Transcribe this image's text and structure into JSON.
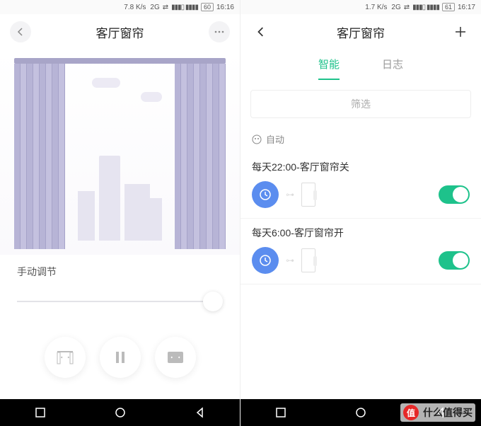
{
  "left": {
    "status": {
      "speed": "7.8 K/s",
      "net": "2G",
      "signal": "⁴ᴳ‖‖ ‖‖",
      "battery": "60",
      "time": "16:16"
    },
    "header": {
      "title": "客厅窗帘"
    },
    "manual_label": "手动调节",
    "controls": {
      "open": "open-curtain",
      "pause": "pause",
      "close": "close-curtain"
    }
  },
  "right": {
    "status": {
      "speed": "1.7 K/s",
      "net": "2G",
      "signal": "⁴ᴳ‖‖ ‖‖",
      "battery": "61",
      "time": "16:17"
    },
    "header": {
      "title": "客厅窗帘"
    },
    "tabs": {
      "smart": "智能",
      "log": "日志"
    },
    "filter": "筛选",
    "section": "自动",
    "rules": [
      {
        "title": "每天22:00-客厅窗帘关",
        "enabled": true
      },
      {
        "title": "每天6:00-客厅窗帘开",
        "enabled": true
      }
    ]
  },
  "watermark": "什么值得买"
}
